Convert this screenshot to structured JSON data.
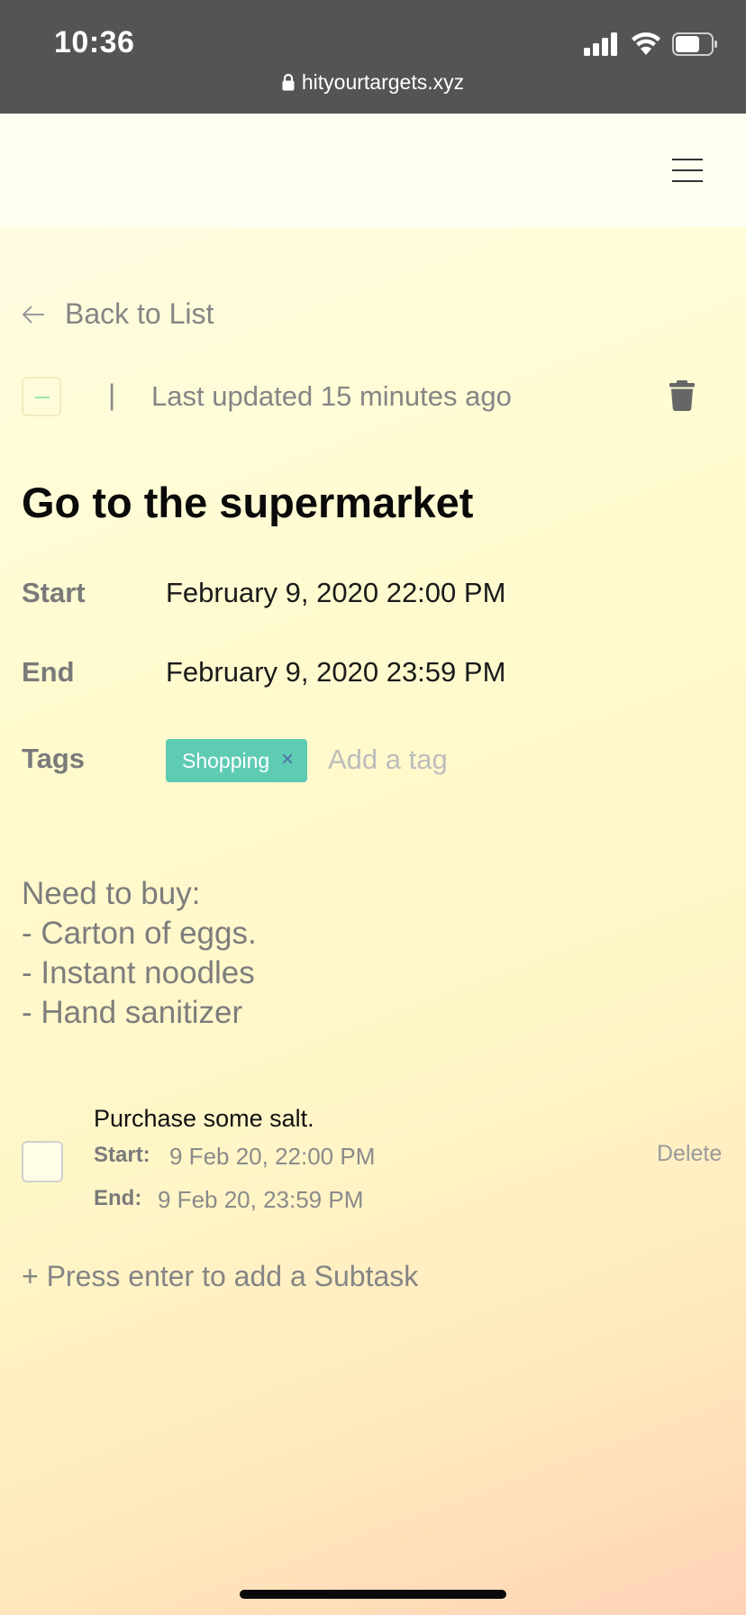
{
  "status_bar": {
    "time": "10:36",
    "url": "hityourtargets.xyz",
    "icons": [
      "signal-icon",
      "wifi-icon",
      "battery-icon",
      "lock-icon"
    ]
  },
  "header": {
    "menu_icon": "hamburger-icon"
  },
  "nav": {
    "back_label": "Back to List"
  },
  "task": {
    "separator": "|",
    "last_updated": "Last updated 15 minutes ago",
    "title": "Go to the supermarket",
    "start_label": "Start",
    "start_value": "February 9, 2020 22:00 PM",
    "end_label": "End",
    "end_value": "February 9, 2020 23:59 PM",
    "tags_label": "Tags",
    "tags": [
      {
        "label": "Shopping",
        "remove_glyph": "×"
      }
    ],
    "tag_placeholder": "Add a tag",
    "notes": [
      "Need to buy:",
      "- Carton of eggs.",
      "- Instant noodles",
      "- Hand sanitizer"
    ]
  },
  "subtasks": [
    {
      "title": "Purchase some salt.",
      "start_label": "Start:",
      "start_value": "9 Feb 20, 22:00 PM",
      "end_label": "End:",
      "end_value": "9 Feb 20, 23:59 PM",
      "delete_label": "Delete",
      "completed": false
    }
  ],
  "add_subtask_placeholder": "+ Press enter to add a Subtask",
  "colors": {
    "status_bar_bg": "#545454",
    "tag_bg": "#5ecbb3",
    "tag_remove": "#4f6fa8",
    "title": "#0a0a0a"
  }
}
